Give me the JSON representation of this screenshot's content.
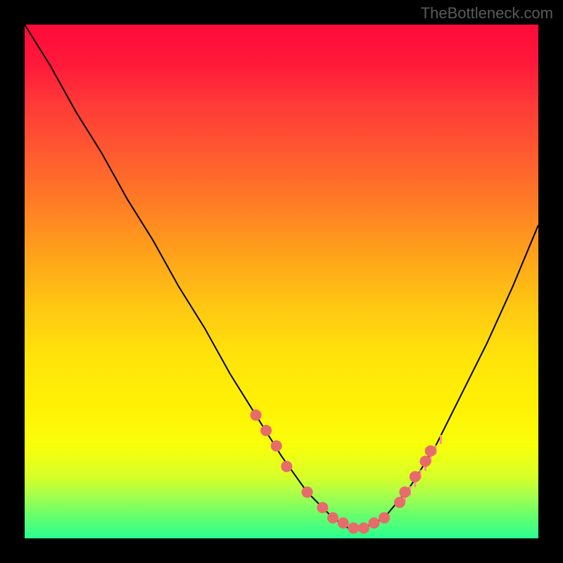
{
  "watermark": "TheBottleneck.com",
  "chart_data": {
    "type": "line",
    "title": "",
    "xlabel": "",
    "ylabel": "",
    "xlim": [
      0,
      100
    ],
    "ylim": [
      0,
      100
    ],
    "grid": false,
    "series": [
      {
        "name": "bottleneck-curve",
        "x": [
          0,
          5,
          10,
          15,
          20,
          25,
          30,
          35,
          40,
          45,
          50,
          55,
          60,
          63,
          66,
          70,
          75,
          80,
          85,
          90,
          95,
          100
        ],
        "y": [
          100,
          92,
          83,
          75,
          66,
          58,
          49,
          41,
          32,
          24,
          16,
          9,
          4,
          2,
          2,
          4,
          10,
          18,
          28,
          38,
          49,
          61
        ]
      }
    ],
    "markers": {
      "name": "highlight-dots",
      "color": "#e86b6b",
      "points": [
        {
          "x": 45,
          "y": 24
        },
        {
          "x": 47,
          "y": 21
        },
        {
          "x": 49,
          "y": 18
        },
        {
          "x": 51,
          "y": 14
        },
        {
          "x": 55,
          "y": 9
        },
        {
          "x": 58,
          "y": 6
        },
        {
          "x": 60,
          "y": 4
        },
        {
          "x": 62,
          "y": 3
        },
        {
          "x": 64,
          "y": 2
        },
        {
          "x": 66,
          "y": 2
        },
        {
          "x": 68,
          "y": 3
        },
        {
          "x": 70,
          "y": 4
        },
        {
          "x": 73,
          "y": 7
        },
        {
          "x": 74,
          "y": 9
        },
        {
          "x": 76,
          "y": 12
        },
        {
          "x": 78,
          "y": 15
        },
        {
          "x": 79,
          "y": 17
        }
      ]
    },
    "ticks": {
      "color": "#ff9090",
      "x_positions": [
        73,
        74,
        75,
        76,
        77,
        78,
        79,
        80,
        81
      ]
    }
  }
}
